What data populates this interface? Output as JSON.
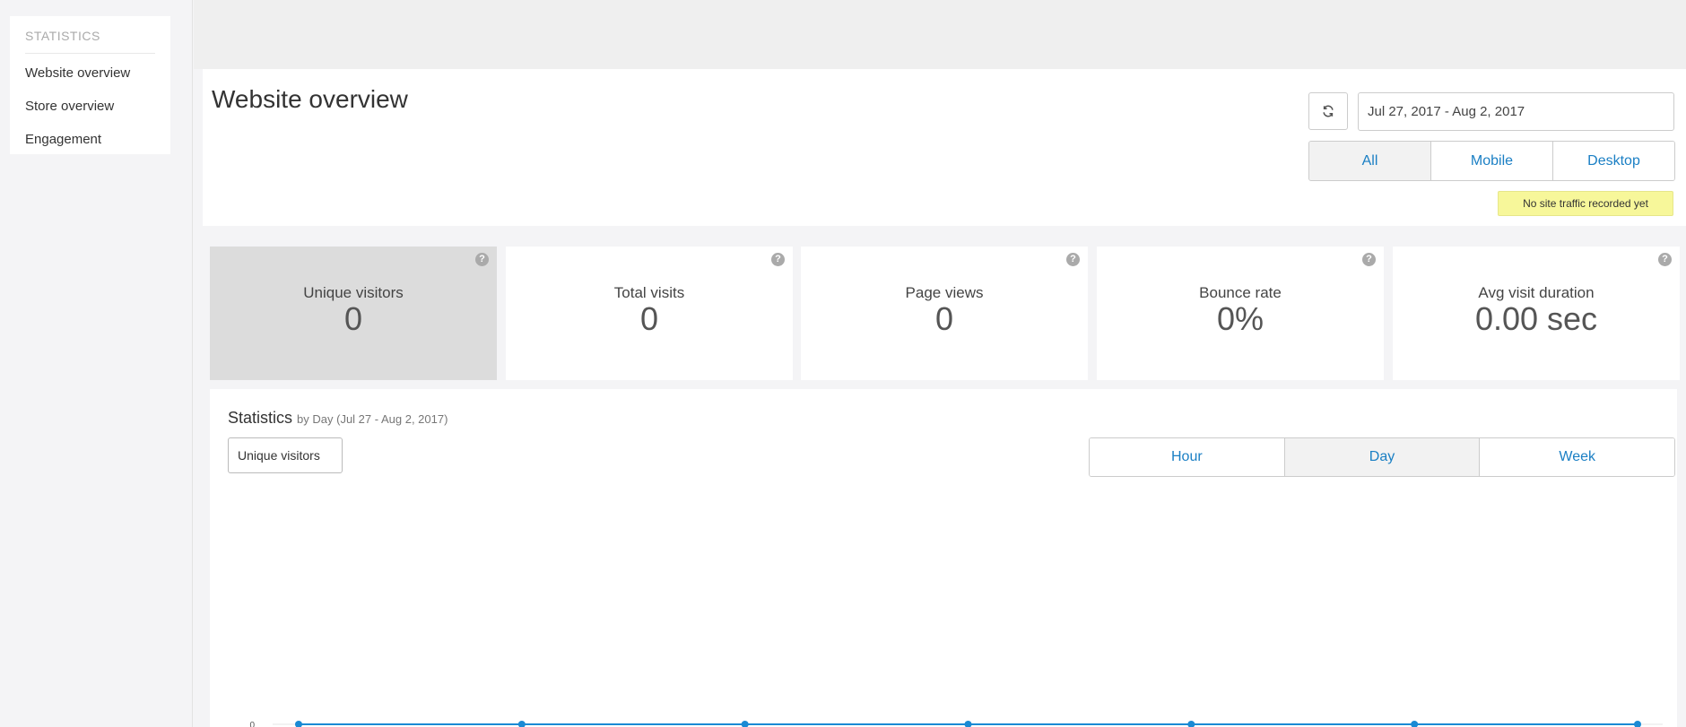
{
  "sidebar": {
    "heading": "STATISTICS",
    "items": [
      {
        "label": "Website overview"
      },
      {
        "label": "Store overview"
      },
      {
        "label": "Engagement"
      }
    ]
  },
  "header": {
    "title": "Website overview",
    "date_range": "Jul 27, 2017 - Aug 2, 2017",
    "devices": [
      "All",
      "Mobile",
      "Desktop"
    ],
    "active_device": "All",
    "notice": "No site traffic recorded yet"
  },
  "cards": [
    {
      "label": "Unique visitors",
      "value": "0",
      "active": true
    },
    {
      "label": "Total visits",
      "value": "0",
      "active": false
    },
    {
      "label": "Page views",
      "value": "0",
      "active": false
    },
    {
      "label": "Bounce rate",
      "value": "0%",
      "active": false
    },
    {
      "label": "Avg visit duration",
      "value": "0.00 sec",
      "active": false
    }
  ],
  "stats": {
    "title": "Statistics",
    "subtitle": "by Day (Jul 27 - Aug 2, 2017)",
    "metric": "Unique visitors",
    "ranges": [
      "Hour",
      "Day",
      "Week"
    ],
    "active_range": "Day"
  },
  "colors": {
    "accent": "#1a7fc4",
    "line": "#1a8ad4",
    "notice_bg": "#f7f79a"
  },
  "chart_data": {
    "type": "line",
    "x": [
      1,
      2,
      3,
      4,
      5,
      6,
      7
    ],
    "series": [
      {
        "values": [
          0,
          0,
          0,
          0,
          0,
          0,
          0
        ]
      }
    ],
    "y_tick_labels": [
      "0"
    ],
    "grid": false
  }
}
